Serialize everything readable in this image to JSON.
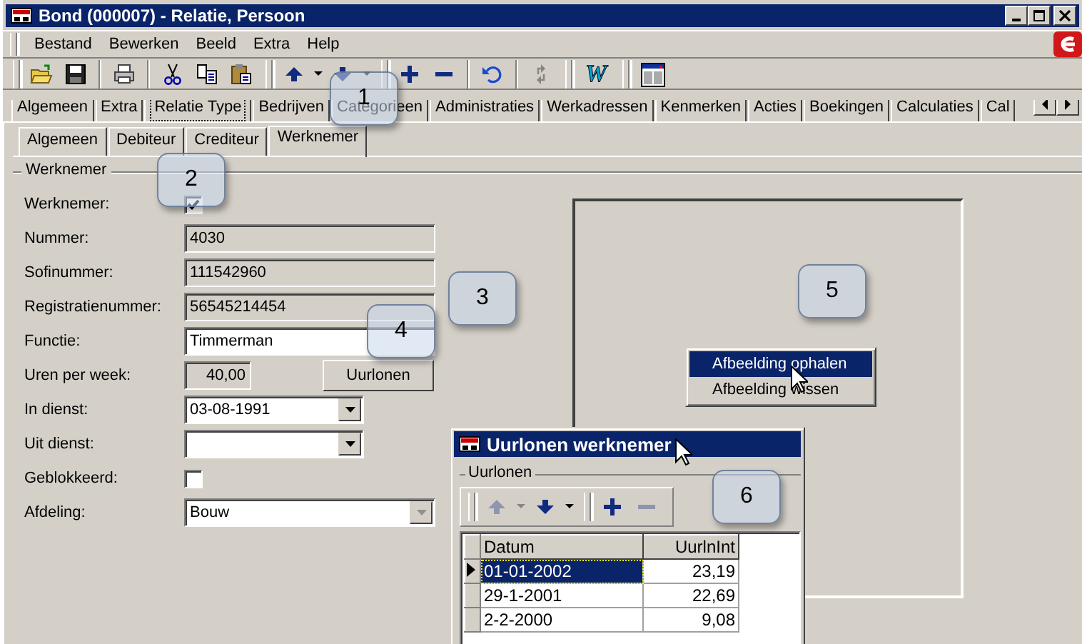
{
  "window": {
    "title": "Bond (000007) - Relatie, Persoon"
  },
  "menu": [
    {
      "label": "Bestand"
    },
    {
      "label": "Bewerken"
    },
    {
      "label": "Beeld"
    },
    {
      "label": "Extra"
    },
    {
      "label": "Help"
    }
  ],
  "toolbar": [
    {
      "kind": "grip"
    },
    {
      "kind": "open",
      "disabled": false
    },
    {
      "kind": "save",
      "disabled": false
    },
    {
      "kind": "sep"
    },
    {
      "kind": "print",
      "disabled": false
    },
    {
      "kind": "sep"
    },
    {
      "kind": "cut",
      "disabled": false
    },
    {
      "kind": "copy",
      "disabled": false
    },
    {
      "kind": "paste",
      "disabled": false
    },
    {
      "kind": "grip"
    },
    {
      "kind": "up",
      "disabled": false
    },
    {
      "kind": "drop",
      "disabled": false
    },
    {
      "kind": "down",
      "disabled": false
    },
    {
      "kind": "drop",
      "disabled": false
    },
    {
      "kind": "grip"
    },
    {
      "kind": "plus",
      "disabled": false
    },
    {
      "kind": "minus",
      "disabled": false
    },
    {
      "kind": "sep"
    },
    {
      "kind": "undo",
      "disabled": false
    },
    {
      "kind": "sep"
    },
    {
      "kind": "refresh",
      "disabled": true
    },
    {
      "kind": "grip"
    },
    {
      "kind": "letter",
      "text": "W",
      "disabled": false
    },
    {
      "kind": "grip"
    },
    {
      "kind": "layout",
      "disabled": false
    }
  ],
  "tabs": [
    {
      "label": "Algemeen",
      "selected": false
    },
    {
      "label": "Extra",
      "selected": false
    },
    {
      "label": "Relatie Type",
      "selected": true
    },
    {
      "label": "Bedrijven",
      "selected": false
    },
    {
      "label": "Categorieen",
      "selected": false
    },
    {
      "label": "Administraties",
      "selected": false
    },
    {
      "label": "Werkadressen",
      "selected": false
    },
    {
      "label": "Kenmerken",
      "selected": false
    },
    {
      "label": "Acties",
      "selected": false
    },
    {
      "label": "Boekingen",
      "selected": false
    },
    {
      "label": "Calculaties",
      "selected": false
    },
    {
      "label": "Cal",
      "selected": false
    }
  ],
  "subtabs": [
    {
      "label": "Algemeen",
      "selected": false
    },
    {
      "label": "Debiteur",
      "selected": false
    },
    {
      "label": "Crediteur",
      "selected": false
    },
    {
      "label": "Werknemer",
      "selected": true
    }
  ],
  "group": {
    "title": "Werknemer"
  },
  "fields": [
    {
      "label": "Werknemer:",
      "kind": "checkbox",
      "checked": true
    },
    {
      "label": "Nummer:",
      "kind": "text",
      "value": "4030",
      "disabled": true
    },
    {
      "label": "Sofinummer:",
      "kind": "text",
      "value": "111542960",
      "disabled": true
    },
    {
      "label": "Registratienummer:",
      "kind": "text",
      "value": "56545214454",
      "disabled": true
    },
    {
      "label": "Functie:",
      "kind": "text",
      "value": "Timmerman",
      "disabled": false
    },
    {
      "label": "Uren per week:",
      "kind": "number",
      "value": "40,00",
      "button": "Uurlonen"
    },
    {
      "label": "In dienst:",
      "kind": "combo",
      "value": "03-08-1991",
      "disabled": false
    },
    {
      "label": "Uit dienst:",
      "kind": "combo",
      "disabled": false
    },
    {
      "label": "Geblokkeerd:",
      "kind": "checkbox",
      "checked": false
    },
    {
      "label": "Afdeling:",
      "kind": "combo",
      "value": "Bouw",
      "disabled": true
    }
  ],
  "context_menu": [
    {
      "label": "Afbeelding ophalen",
      "selected": true
    },
    {
      "label": "Afbeelding wissen",
      "selected": false
    }
  ],
  "dialog": {
    "title": "Uurlonen werknemer",
    "group": "Uurlonen",
    "toolbar": [
      {
        "kind": "grip"
      },
      {
        "kind": "up",
        "disabled": true
      },
      {
        "kind": "drop",
        "disabled": true
      },
      {
        "kind": "down",
        "disabled": false
      },
      {
        "kind": "drop",
        "disabled": false
      },
      {
        "kind": "grip"
      },
      {
        "kind": "plus",
        "disabled": false
      },
      {
        "kind": "minus",
        "disabled": true
      }
    ],
    "columns": [
      "Datum",
      "UurlnInt"
    ],
    "rows": [
      {
        "cells": [
          "01-01-2002",
          "23,19"
        ],
        "selected": true
      },
      {
        "cells": [
          "29-1-2001",
          "22,69"
        ],
        "selected": false
      },
      {
        "cells": [
          "2-2-2000",
          "9,08"
        ],
        "selected": false
      }
    ]
  },
  "callouts": [
    {
      "label": "1"
    },
    {
      "label": "2"
    },
    {
      "label": "3"
    },
    {
      "label": "4"
    },
    {
      "label": "5"
    },
    {
      "label": "6"
    }
  ]
}
